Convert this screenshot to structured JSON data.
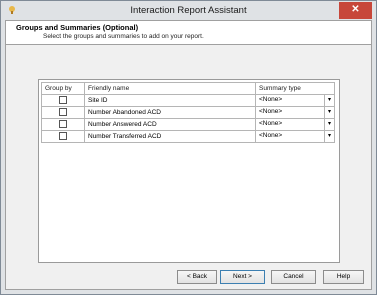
{
  "window": {
    "title": "Interaction Report Assistant",
    "close_glyph": "✕"
  },
  "header": {
    "title": "Groups and Summaries (Optional)",
    "subtitle": "Select the groups and summaries to add on your report."
  },
  "grid": {
    "columns": [
      "Group by",
      "Friendly name",
      "Summary type"
    ],
    "rows": [
      {
        "checked": false,
        "name": "Site ID",
        "summary": "<None>"
      },
      {
        "checked": false,
        "name": "Number Abandoned ACD",
        "summary": "<None>"
      },
      {
        "checked": false,
        "name": "Number Answered ACD",
        "summary": "<None>"
      },
      {
        "checked": false,
        "name": "Number Transferred ACD",
        "summary": "<None>"
      }
    ]
  },
  "buttons": {
    "back": "< Back",
    "next": "Next >",
    "cancel": "Cancel",
    "help": "Help"
  },
  "colors": {
    "close_bg": "#c7473a",
    "header_bg": "#ffffff",
    "client_bg": "#f0f0f0"
  }
}
